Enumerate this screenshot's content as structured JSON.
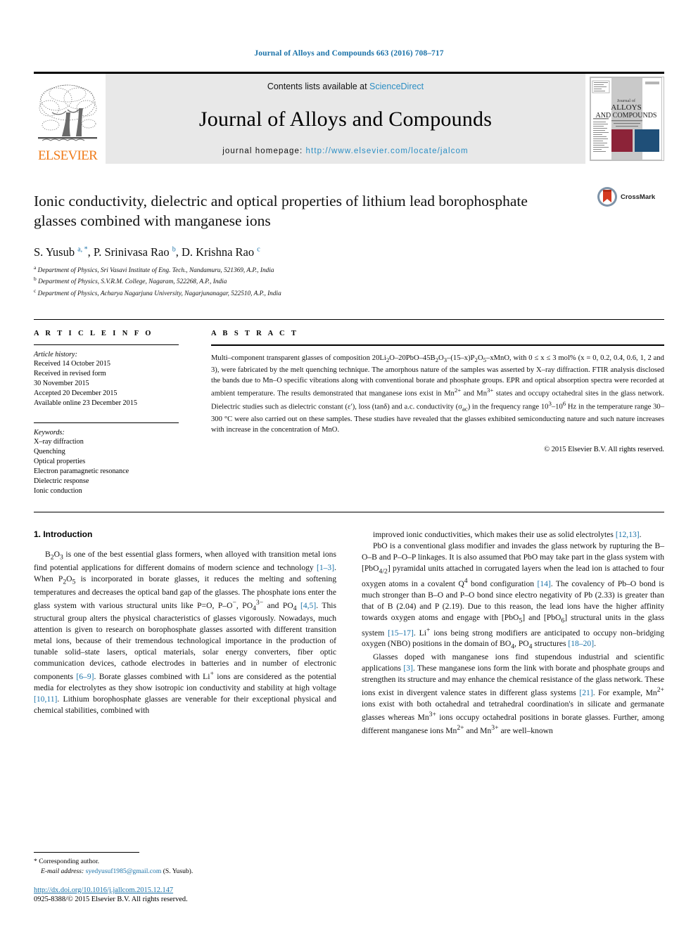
{
  "running_head": "Journal of Alloys and Compounds 663 (2016) 708–717",
  "masthead": {
    "publisher": "ELSEVIER",
    "contents_prefix": "Contents lists available at ",
    "contents_link": "ScienceDirect",
    "journal_title": "Journal of Alloys and Compounds",
    "homepage_prefix": "journal homepage: ",
    "homepage_url": "http://www.elsevier.com/locate/jalcom",
    "cover": {
      "line1": "Journal of",
      "line2": "ALLOYS",
      "line3": "AND COMPOUNDS"
    }
  },
  "article": {
    "title": "Ionic conductivity, dielectric and optical properties of lithium lead borophosphate glasses combined with manganese ions",
    "crossmark_label": "CrossMark",
    "authors_html": "S. Yusub <sup>a, *</sup>, P. Srinivasa Rao <sup>b</sup>, D. Krishna Rao <sup>c</sup>",
    "affiliations": [
      {
        "marker": "a",
        "text": "Department of Physics, Sri Vasavi Institute of Eng. Tech., Nandamuru, 521369, A.P., India"
      },
      {
        "marker": "b",
        "text": "Department of Physics, S.V.R.M. College, Nagaram, 522268, A.P., India"
      },
      {
        "marker": "c",
        "text": "Department of Physics, Acharya Nagarjuna University, Nagarjunanagar, 522510, A.P., India"
      }
    ]
  },
  "article_info": {
    "heading": "A R T I C L E    I N F O",
    "history_label": "Article history:",
    "history": [
      "Received 14 October 2015",
      "Received in revised form",
      "30 November 2015",
      "Accepted 20 December 2015",
      "Available online 23 December 2015"
    ],
    "keywords_label": "Keywords:",
    "keywords": [
      "X–ray diffraction",
      "Quenching",
      "Optical properties",
      "Electron paramagnetic resonance",
      "Dielectric response",
      "Ionic conduction"
    ]
  },
  "abstract": {
    "heading": "A B S T R A C T",
    "text_html": "Multi–component transparent glasses of composition 20Li<sub>2</sub>O–20PbO–45B<sub>2</sub>O<sub>3</sub>–(15–x)P<sub>2</sub>O<sub>5</sub>–xMnO, with 0 ≤ x ≤ 3 mol% (x = 0, 0.2, 0.4, 0.6, 1, 2 and 3), were fabricated by the melt quenching technique. The amorphous nature of the samples was asserted by X–ray diffraction. FTIR analysis disclosed the bands due to Mn–O specific vibrations along with conventional borate and phosphate groups. EPR and optical absorption spectra were recorded at ambient temperature. The results demonstrated that manganese ions exist in Mn<sup>2+</sup> and Mn<sup>3+</sup> states and occupy octahedral sites in the glass network. Dielectric studies such as dielectric constant (ε′), loss (tanδ) and a.c. conductivity (σ<sub>ac</sub>) in the frequency range 10<sup>3</sup>–10<sup>6</sup> Hz in the temperature range 30–300 °C were also carried out on these samples. These studies have revealed that the glasses exhibited semiconducting nature and such nature increases with increase in the concentration of MnO.",
    "copyright": "© 2015 Elsevier B.V. All rights reserved."
  },
  "body": {
    "section_heading": "1.  Introduction",
    "left_paragraphs_html": [
      "B<sub>2</sub>O<sub>3</sub> is one of the best essential glass formers, when alloyed with transition metal ions find potential applications for different domains of modern science and technology <span class=\"ref\">[1–3]</span>. When P<sub>2</sub>O<sub>5</sub> is incorporated in borate glasses, it reduces the melting and softening temperatures and decreases the optical band gap of the glasses. The phosphate ions enter the glass system with various structural units like P&#61;O, P–O<sup>−</sup>, PO<sub>4</sub><sup>3−</sup> and PO<sub>4</sub> <span class=\"ref\">[4,5]</span>. This structural group alters the physical characteristics of glasses vigorously. Nowadays, much attention is given to research on borophosphate glasses assorted with different transition metal ions, because of their tremendous technological importance in the production of tunable solid–state lasers, optical materials, solar energy converters, fiber optic communication devices, cathode electrodes in batteries and in number of electronic components <span class=\"ref\">[6–9]</span>. Borate glasses combined with Li<sup>+</sup> ions are considered as the potential media for electrolytes as they show isotropic ion conductivity and stability at high voltage <span class=\"ref\">[10,11]</span>. Lithium borophosphate glasses are venerable for their exceptional physical and chemical stabilities, combined with"
    ],
    "right_paragraphs_html": [
      "improved ionic conductivities, which makes their use as solid electrolytes <span class=\"ref\">[12,13]</span>.",
      "PbO is a conventional glass modifier and invades the glass network by rupturing the B–O–B and P–O–P linkages. It is also assumed that PbO may take part in the glass system with [PbO<sub>4/2</sub>] pyramidal units attached in corrugated layers when the lead ion is attached to four oxygen atoms in a covalent Q<sup>4</sup> bond configuration <span class=\"ref\">[14]</span>. The covalency of Pb–O bond is much stronger than B–O and P–O bond since electro negativity of Pb (2.33) is greater than that of B (2.04) and P (2.19). Due to this reason, the lead ions have the higher affinity towards oxygen atoms and engage with [PbO<sub>5</sub>] and [PbO<sub>6</sub>] structural units in the glass system <span class=\"ref\">[15–17]</span>. Li<sup>+</sup> ions being strong modifiers are anticipated to occupy non–bridging oxygen (NBO) positions in the domain of BO<sub>4</sub>, PO<sub>4</sub> structures <span class=\"ref\">[18–20]</span>.",
      "Glasses doped with manganese ions find stupendous industrial and scientific applications <span class=\"ref\">[3]</span>. These manganese ions form the link with borate and phosphate groups and strengthen its structure and may enhance the chemical resistance of the glass network. These ions exist in divergent valence states in different glass systems <span class=\"ref\">[21]</span>. For example, Mn<sup>2+</sup> ions exist with both octahedral and tetrahedral coordination's in silicate and germanate glasses whereas Mn<sup>3+</sup> ions occupy octahedral positions in borate glasses. Further, among different manganese ions Mn<sup>2+</sup> and Mn<sup>3+</sup> are well–known"
    ]
  },
  "footer": {
    "corresponding_marker": "*",
    "corresponding_label": "Corresponding author.",
    "email_label": "E-mail address:",
    "email": "syedyusuf1985@gmail.com",
    "email_suffix": "(S. Yusub).",
    "doi": "http://dx.doi.org/10.1016/j.jallcom.2015.12.147",
    "issn_line": "0925-8388/© 2015 Elsevier B.V. All rights reserved."
  },
  "colors": {
    "link_blue": "#1b72a8",
    "sd_blue": "#2b8ec4",
    "elsevier_orange": "#f07c1b",
    "cover_red": "#8c2338",
    "cover_navy": "#1f4f78",
    "masthead_gray": "#e8e8e8"
  }
}
